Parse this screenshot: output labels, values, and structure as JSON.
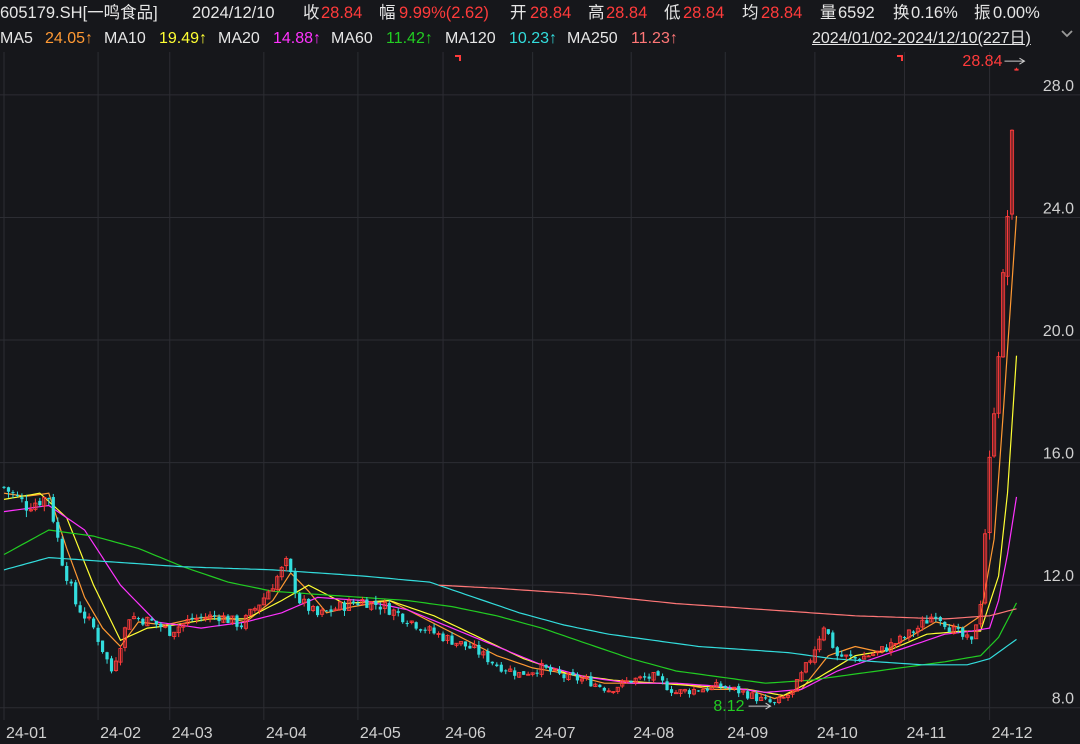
{
  "header": {
    "symbol": "605179.SH[一鸣食品]",
    "date": "2024/12/10",
    "close_label": "收",
    "close_value": "28.84",
    "change_label": "幅",
    "change_value": "9.99%(2.62)",
    "open_label": "开",
    "open_value": "28.84",
    "high_label": "高",
    "high_value": "28.84",
    "low_label": "低",
    "low_value": "28.84",
    "avg_label": "均",
    "avg_value": "28.84",
    "volume_label": "量",
    "volume_value": "6592",
    "turnover_label": "换",
    "turnover_value": "0.16%",
    "amplitude_label": "振",
    "amplitude_value": "0.00%"
  },
  "ma_legend": [
    {
      "label": "MA5",
      "value": "24.05↑",
      "color": "#ff9933"
    },
    {
      "label": "MA10",
      "value": "19.49↑",
      "color": "#ffff33"
    },
    {
      "label": "MA20",
      "value": "14.88↑",
      "color": "#ff33ff"
    },
    {
      "label": "MA60",
      "value": "11.42↑",
      "color": "#22cc22"
    },
    {
      "label": "MA120",
      "value": "10.23↑",
      "color": "#33dddd"
    },
    {
      "label": "MA250",
      "value": "11.23↑",
      "color": "#ff7777"
    }
  ],
  "date_range": "2024/01/02-2024/12/10(227日)",
  "more_icon": "chevron-icon",
  "colors": {
    "up": "#ff3b3b",
    "down": "#33dddd",
    "grid": "#2c2d33",
    "axis_text": "#d0d0d0"
  },
  "chart_data": {
    "type": "candlestick",
    "y_ticks": [
      "28.0",
      "24.0",
      "20.0",
      "16.0",
      "12.0",
      "8.0"
    ],
    "y_tick_values": [
      28,
      24,
      20,
      16,
      12,
      8
    ],
    "ylim": [
      7.6,
      29.4
    ],
    "x_ticks": [
      "24-01",
      "24-02",
      "24-03",
      "24-04",
      "24-05",
      "24-06",
      "24-07",
      "24-08",
      "24-09",
      "24-10",
      "24-11",
      "24-12"
    ],
    "x_tick_index": [
      0,
      21,
      37,
      58,
      79,
      98,
      118,
      140,
      161,
      181,
      201,
      220
    ],
    "high_label": "28.84",
    "low_label": "8.12",
    "high_index": 226,
    "low_index": 172,
    "anchors": {
      "close_i": [
        0,
        5,
        10,
        13,
        16,
        20,
        24,
        28,
        33,
        37,
        42,
        48,
        53,
        58,
        63,
        66,
        70,
        75,
        80,
        85,
        90,
        95,
        100,
        105,
        110,
        115,
        120,
        125,
        130,
        135,
        140,
        145,
        150,
        155,
        160,
        165,
        170,
        172,
        176,
        180,
        183,
        186,
        190,
        195,
        200,
        204,
        208,
        212,
        216,
        218,
        220,
        222,
        224,
        226
      ],
      "close_v": [
        15.2,
        14.6,
        14.9,
        12.8,
        11.4,
        10.6,
        9.2,
        11.0,
        10.8,
        10.5,
        10.9,
        11.0,
        10.7,
        11.6,
        12.7,
        11.5,
        11.0,
        11.3,
        11.5,
        11.3,
        10.9,
        10.5,
        10.2,
        9.9,
        9.4,
        9.1,
        9.3,
        9.0,
        8.9,
        8.6,
        8.9,
        9.0,
        8.5,
        8.6,
        8.7,
        8.5,
        8.2,
        8.12,
        8.5,
        9.6,
        10.7,
        9.7,
        9.6,
        9.8,
        10.2,
        10.6,
        11.1,
        10.5,
        10.1,
        11.5,
        16.0,
        19.7,
        24.1,
        28.84
      ]
    },
    "moving_averages": [
      {
        "name": "MA5",
        "color": "#ff9933",
        "x": [
          0,
          5,
          10,
          14,
          18,
          22,
          26,
          30,
          36,
          42,
          48,
          54,
          60,
          64,
          68,
          72,
          78,
          86,
          94,
          102,
          110,
          118,
          126,
          134,
          142,
          150,
          158,
          166,
          172,
          178,
          184,
          190,
          196,
          202,
          208,
          214,
          218,
          221,
          223,
          226
        ],
        "y": [
          15.0,
          14.9,
          15.0,
          13.2,
          11.6,
          10.6,
          10.0,
          10.8,
          10.7,
          10.9,
          11.0,
          10.8,
          11.5,
          12.4,
          11.8,
          11.1,
          11.3,
          11.5,
          10.9,
          10.3,
          9.7,
          9.3,
          9.1,
          8.8,
          8.8,
          8.8,
          8.6,
          8.6,
          8.3,
          8.6,
          9.7,
          10.0,
          9.8,
          10.3,
          10.8,
          10.6,
          11.0,
          13.5,
          17.5,
          24.05
        ]
      },
      {
        "name": "MA10",
        "color": "#ffff33",
        "x": [
          0,
          8,
          14,
          20,
          26,
          32,
          38,
          46,
          54,
          62,
          68,
          76,
          86,
          96,
          106,
          116,
          126,
          136,
          146,
          156,
          166,
          174,
          182,
          190,
          198,
          206,
          214,
          218,
          222,
          224,
          226
        ],
        "y": [
          14.8,
          15.0,
          14.2,
          12.0,
          10.2,
          10.6,
          10.7,
          10.9,
          10.9,
          11.5,
          12.0,
          11.4,
          11.5,
          11.0,
          10.3,
          9.6,
          9.1,
          8.9,
          8.8,
          8.7,
          8.6,
          8.4,
          9.0,
          9.7,
          9.9,
          10.4,
          10.5,
          10.5,
          12.3,
          15.0,
          19.49
        ]
      },
      {
        "name": "MA20",
        "color": "#ff33ff",
        "x": [
          0,
          10,
          18,
          26,
          34,
          44,
          54,
          62,
          70,
          80,
          90,
          100,
          110,
          120,
          130,
          140,
          150,
          160,
          170,
          178,
          186,
          194,
          202,
          210,
          216,
          220,
          222,
          224,
          226
        ],
        "y": [
          14.4,
          14.6,
          13.8,
          12.0,
          10.8,
          10.6,
          10.8,
          11.1,
          11.6,
          11.5,
          11.2,
          10.6,
          10.0,
          9.4,
          9.0,
          8.8,
          8.8,
          8.7,
          8.5,
          8.6,
          9.2,
          9.6,
          10.0,
          10.4,
          10.5,
          10.6,
          11.5,
          13.0,
          14.88
        ]
      },
      {
        "name": "MA60",
        "color": "#22cc22",
        "x": [
          0,
          10,
          20,
          30,
          40,
          50,
          60,
          70,
          80,
          90,
          100,
          110,
          120,
          130,
          140,
          150,
          160,
          170,
          180,
          190,
          200,
          210,
          218,
          222,
          226
        ],
        "y": [
          13.0,
          13.8,
          13.6,
          13.2,
          12.6,
          12.1,
          11.8,
          11.7,
          11.6,
          11.5,
          11.3,
          11.0,
          10.6,
          10.1,
          9.6,
          9.2,
          9.0,
          8.8,
          8.9,
          9.1,
          9.3,
          9.5,
          9.7,
          10.3,
          11.42
        ]
      },
      {
        "name": "MA120",
        "color": "#33dddd",
        "x": [
          0,
          10,
          20,
          40,
          60,
          80,
          95,
          105,
          115,
          125,
          135,
          145,
          155,
          165,
          175,
          185,
          195,
          205,
          215,
          220,
          226
        ],
        "y": [
          12.5,
          12.9,
          12.8,
          12.6,
          12.5,
          12.3,
          12.1,
          11.6,
          11.1,
          10.7,
          10.4,
          10.2,
          10.0,
          9.9,
          9.8,
          9.6,
          9.5,
          9.4,
          9.4,
          9.6,
          10.23
        ]
      },
      {
        "name": "MA250",
        "color": "#ff7777",
        "x": [
          97,
          110,
          130,
          150,
          170,
          190,
          210,
          220,
          226
        ],
        "y": [
          12.0,
          11.9,
          11.7,
          11.4,
          11.2,
          11.0,
          10.9,
          11.0,
          11.23
        ]
      }
    ]
  }
}
